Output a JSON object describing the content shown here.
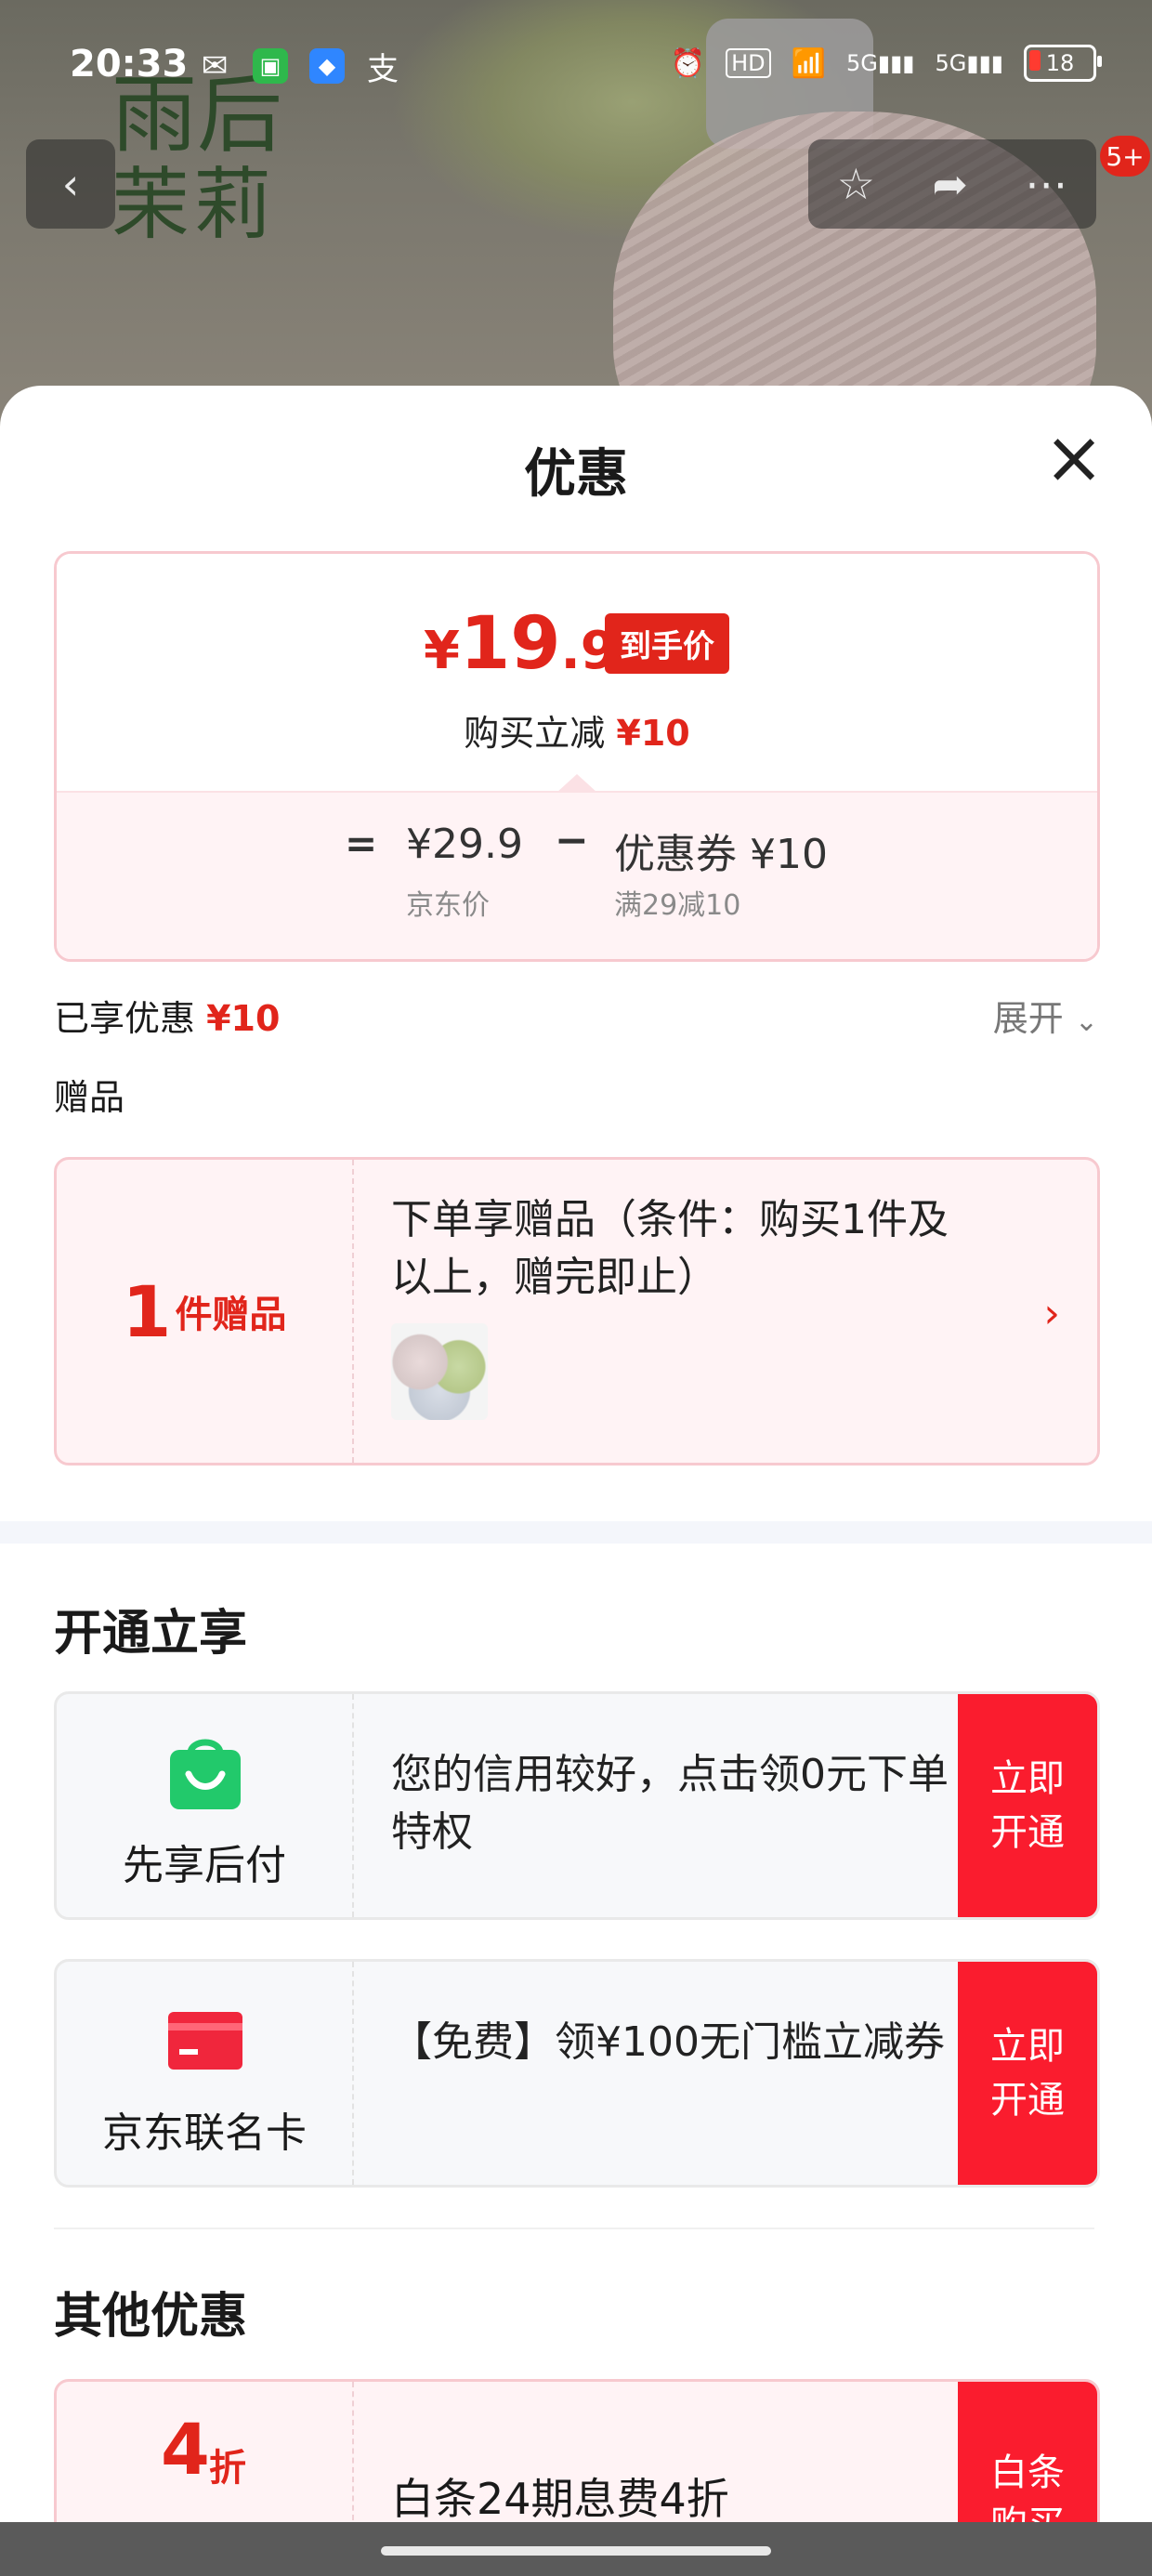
{
  "status_bar": {
    "time": "20:33",
    "signal_1": "5G",
    "signal_2": "5G",
    "battery": "18",
    "hd": "HD"
  },
  "background": {
    "brand_line1": "雨后",
    "brand_line2": "茉莉"
  },
  "top_nav": {
    "badge": "5+"
  },
  "sheet": {
    "title": "优惠",
    "price": {
      "currency": "¥",
      "integer": "19",
      "decimal": ".9",
      "tag": "到手价",
      "reduce_label": "购买立减",
      "reduce_value": "¥10",
      "equals": "=",
      "jd_price": "¥29.9",
      "jd_price_label": "京东价",
      "minus": "−",
      "coupon": "优惠券 ¥10",
      "coupon_rule": "满29减10"
    },
    "enjoyed_label": "已享优惠",
    "enjoyed_value": "¥10",
    "expand_label": "展开",
    "gift_section_label": "赠品",
    "gift": {
      "count": "1",
      "count_unit": "件赠品",
      "text": "下单享赠品（条件：购买1件及以上，赠完即止）"
    },
    "open_section_title": "开通立享",
    "services": [
      {
        "name": "先享后付",
        "desc": "您的信用较好，点击领0元下单特权",
        "button": "立即开通"
      },
      {
        "name": "京东联名卡",
        "desc": "【免费】领¥100无门槛立减券",
        "button": "立即开通"
      }
    ],
    "other_section_title": "其他优惠",
    "other": {
      "discount_num": "4",
      "discount_unit": "折",
      "desc": "白条24期息费4折",
      "button": "白条购买"
    }
  },
  "colors": {
    "accent_red": "#e1251b",
    "button_red": "#fa1c2e",
    "pink_bg": "#fff3f5"
  }
}
